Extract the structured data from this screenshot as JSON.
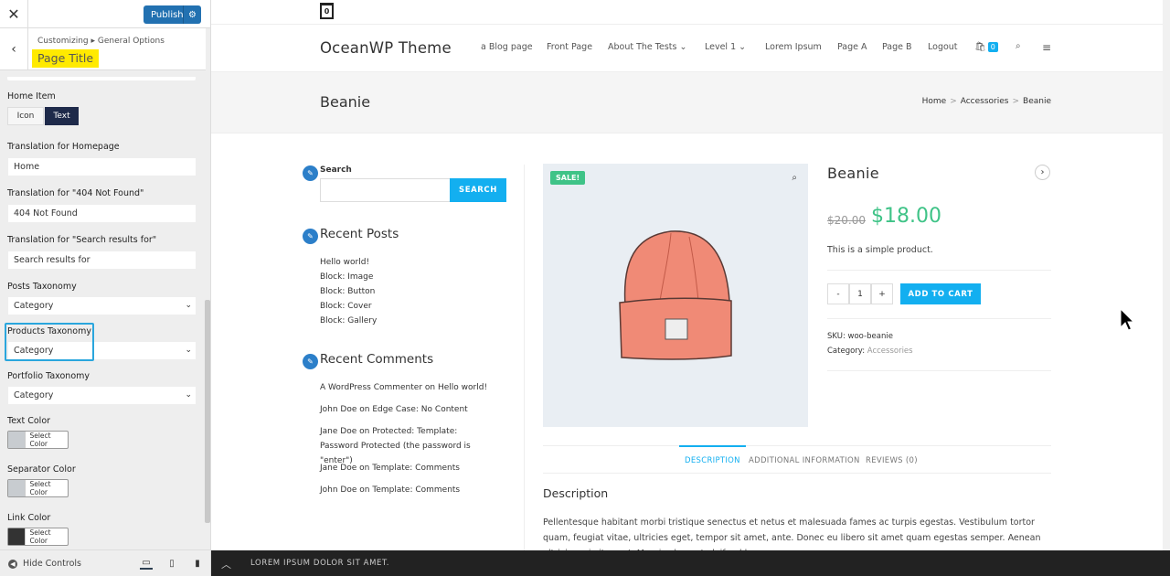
{
  "customizer": {
    "close_icon": "✕",
    "publish_label": "Publish",
    "breadcrumb": "Customizing ▸ General Options",
    "section_title": "Page Title",
    "home_item": {
      "label": "Home Item",
      "options": [
        "Icon",
        "Text"
      ],
      "selected": "Text"
    },
    "fields": [
      {
        "label": "Translation for Homepage",
        "value": "Home"
      },
      {
        "label": "Translation for \"404 Not Found\"",
        "value": "404 Not Found"
      },
      {
        "label": "Translation for \"Search results for\"",
        "value": "Search results for"
      }
    ],
    "selects": [
      {
        "label": "Posts Taxonomy",
        "value": "Category"
      },
      {
        "label": "Products Taxonomy",
        "value": "Category"
      },
      {
        "label": "Portfolio Taxonomy",
        "value": "Category"
      }
    ],
    "colors": [
      {
        "label": "Text Color",
        "button": "Select Color",
        "swatch": "#c8ccd0"
      },
      {
        "label": "Separator Color",
        "button": "Select Color",
        "swatch": "#c8ccd0"
      },
      {
        "label": "Link Color",
        "button": "Select Color",
        "swatch": "#333333"
      }
    ],
    "hide_controls": "Hide Controls",
    "accent": "#2271b1",
    "highlight": "#ffea00"
  },
  "site": {
    "cart_count": "0",
    "logo": "OceanWP Theme",
    "nav": [
      "a Blog page",
      "Front Page",
      "About The Tests",
      "Level 1",
      "Lorem Ipsum",
      "Page A",
      "Page B",
      "Logout"
    ],
    "nav_cart_count": "0",
    "page_title": "Beanie",
    "breadcrumb": [
      "Home",
      "Accessories",
      "Beanie"
    ],
    "sidebar": {
      "search_label": "Search",
      "search_button": "SEARCH",
      "recent_posts_title": "Recent Posts",
      "recent_posts": [
        "Hello world!",
        "Block: Image",
        "Block: Button",
        "Block: Cover",
        "Block: Gallery"
      ],
      "recent_comments_title": "Recent Comments",
      "comments": [
        {
          "author": "A WordPress Commenter",
          "on": "on",
          "post": "Hello world!"
        },
        {
          "author": "John Doe",
          "on": "on",
          "post": "Edge Case: No Content"
        },
        {
          "author": "Jane Doe",
          "on": "on",
          "post": "Protected: Template: Password Protected (the password is \"enter\")"
        },
        {
          "author": "Jane Doe",
          "on": "on",
          "post": "Template: Comments"
        },
        {
          "author": "John Doe",
          "on": "on",
          "post": "Template: Comments"
        }
      ]
    },
    "product": {
      "sale_badge": "SALE!",
      "name": "Beanie",
      "old_price": "$20.00",
      "price": "$18.00",
      "short_desc": "This is a simple product.",
      "qty": "1",
      "minus": "-",
      "plus": "+",
      "add_to_cart": "ADD TO CART",
      "sku_label": "SKU:",
      "sku": "woo-beanie",
      "category_label": "Category:",
      "category": "Accessories",
      "tabs": [
        "DESCRIPTION",
        "ADDITIONAL INFORMATION",
        "REVIEWS (0)"
      ],
      "desc_title": "Description",
      "desc_body": "Pellentesque habitant morbi tristique senectus et netus et malesuada fames ac turpis egestas. Vestibulum tortor quam, feugiat vitae, ultricies eget, tempor sit amet, ante. Donec eu libero sit amet quam egestas semper. Aenean ultricies mi vitae est. Mauris placerat eleifend leo."
    },
    "sticky_bar": "LOREM IPSUM DOLOR SIT AMET.",
    "accent": "#13aff0",
    "price_color": "#3fc387"
  }
}
